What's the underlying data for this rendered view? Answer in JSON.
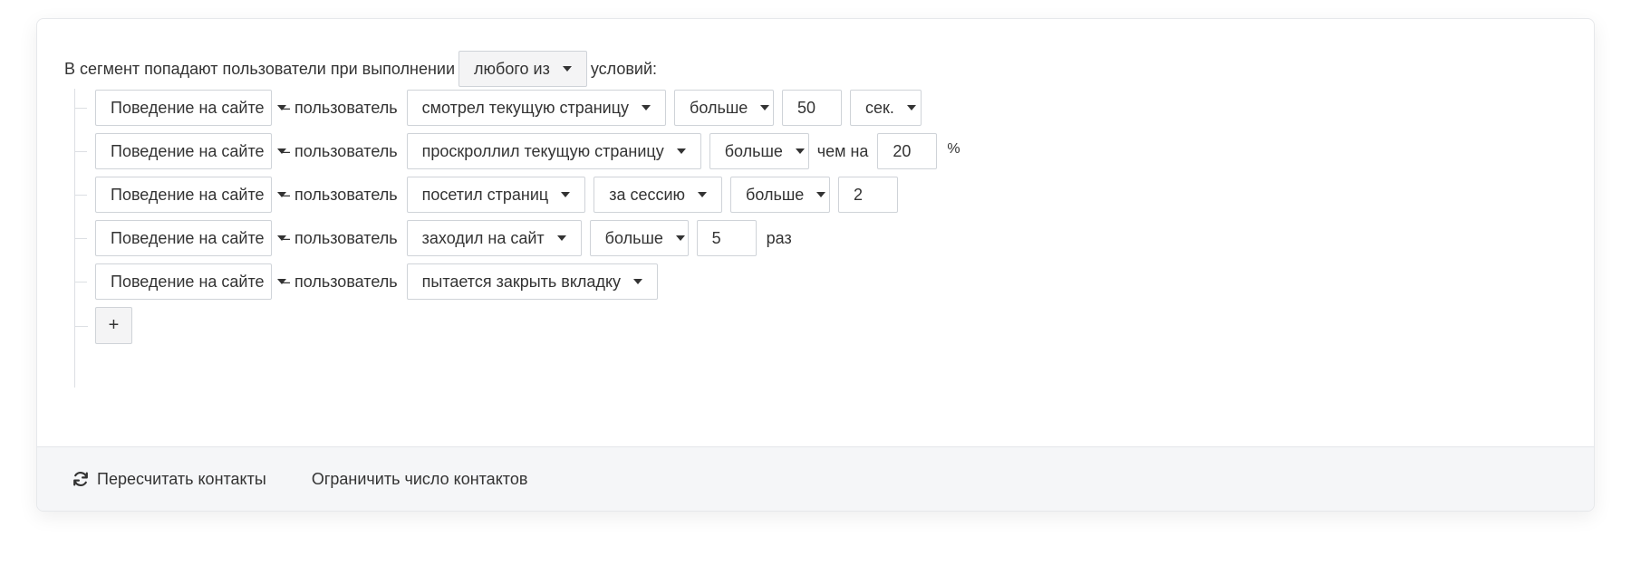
{
  "header": {
    "prefix": "В сегмент попадают пользователи при выполнении",
    "mode_value": "любого из",
    "suffix": "условий:"
  },
  "conditions": [
    {
      "category": "Поведение на сайте",
      "connector": "– пользователь",
      "action": "смотрел текущую страницу",
      "comparator": "больше",
      "value": "50",
      "unit_select": "сек."
    },
    {
      "category": "Поведение на сайте",
      "connector": "– пользователь",
      "action": "проскроллил текущую страницу",
      "comparator": "больше",
      "between_label": "чем на",
      "value": "20",
      "unit": "%"
    },
    {
      "category": "Поведение на сайте",
      "connector": "– пользователь",
      "action": "посетил страниц",
      "period": "за сессию",
      "comparator": "больше",
      "value": "2"
    },
    {
      "category": "Поведение на сайте",
      "connector": "– пользователь",
      "action": "заходил на сайт",
      "comparator": "больше",
      "value": "5",
      "unit": "раз"
    },
    {
      "category": "Поведение на сайте",
      "connector": "– пользователь",
      "action": "пытается закрыть вкладку"
    }
  ],
  "add_button_label": "+",
  "footer": {
    "recalc_label": "Пересчитать контакты",
    "recalc_icon": "refresh-icon",
    "limit_label": "Ограничить число контактов"
  }
}
